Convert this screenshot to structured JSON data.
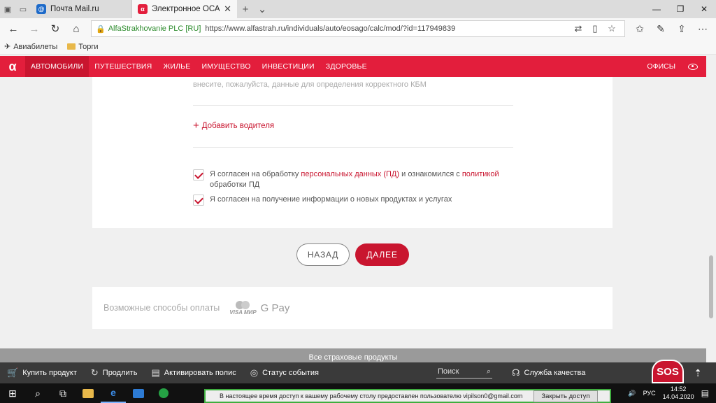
{
  "browser": {
    "tabs": [
      {
        "title": "Почта Mail.ru",
        "active": false
      },
      {
        "title": "Электронное ОСАГО",
        "active": true
      }
    ],
    "address": {
      "org": "AlfaStrakhovanie PLC [RU]",
      "url": "https://www.alfastrah.ru/individuals/auto/eosago/calc/mod/?id=117949839"
    },
    "favorites": [
      "Авиабилеты",
      "Торги"
    ]
  },
  "site": {
    "logo": "α",
    "nav": [
      {
        "label": "АВТОМОБИЛИ",
        "active": true
      },
      {
        "label": "ПУТЕШЕСТВИЯ",
        "active": false
      },
      {
        "label": "ЖИЛЬЕ",
        "active": false
      },
      {
        "label": "ИМУЩЕСТВО",
        "active": false
      },
      {
        "label": "ИНВЕСТИЦИИ",
        "active": false
      },
      {
        "label": "ЗДОРОВЬЕ",
        "active": false
      }
    ],
    "offices": "ОФИСЫ",
    "accent": "#e31e3c"
  },
  "form": {
    "hint_line2": "внесите, пожалуйста, данные для определения корректного КБМ",
    "add_driver": "Добавить водителя",
    "consent1": {
      "prefix": "Я согласен на обработку ",
      "link1": "персональных данных (ПД)",
      "middle": " и ознакомился с ",
      "link2": "политикой",
      "suffix": " обработки ПД",
      "checked": true
    },
    "consent2": {
      "text": "Я согласен на получение информации о новых продуктах и услугах",
      "checked": true
    },
    "back_button": "НАЗАД",
    "next_button": "ДАЛЕЕ"
  },
  "payment": {
    "label": "Возможные способы оплаты",
    "visamir": "VISA МИР",
    "gpay": "G Pay"
  },
  "footer": {
    "all_products": "Все страховые продукты"
  },
  "bottombar": {
    "buy": "Купить продукт",
    "extend": "Продлить",
    "activate": "Активировать полис",
    "status": "Статус события",
    "search_placeholder": "Поиск",
    "quality": "Служба качества",
    "sos": "SOS"
  },
  "taskbar": {
    "notification": "В настоящее время доступ к вашему рабочему столу предоставлен пользователю vipilson0@gmail.com",
    "close_access": "Закрыть доступ",
    "lang": "РУС",
    "time": "14:52",
    "date": "14.04.2020"
  }
}
